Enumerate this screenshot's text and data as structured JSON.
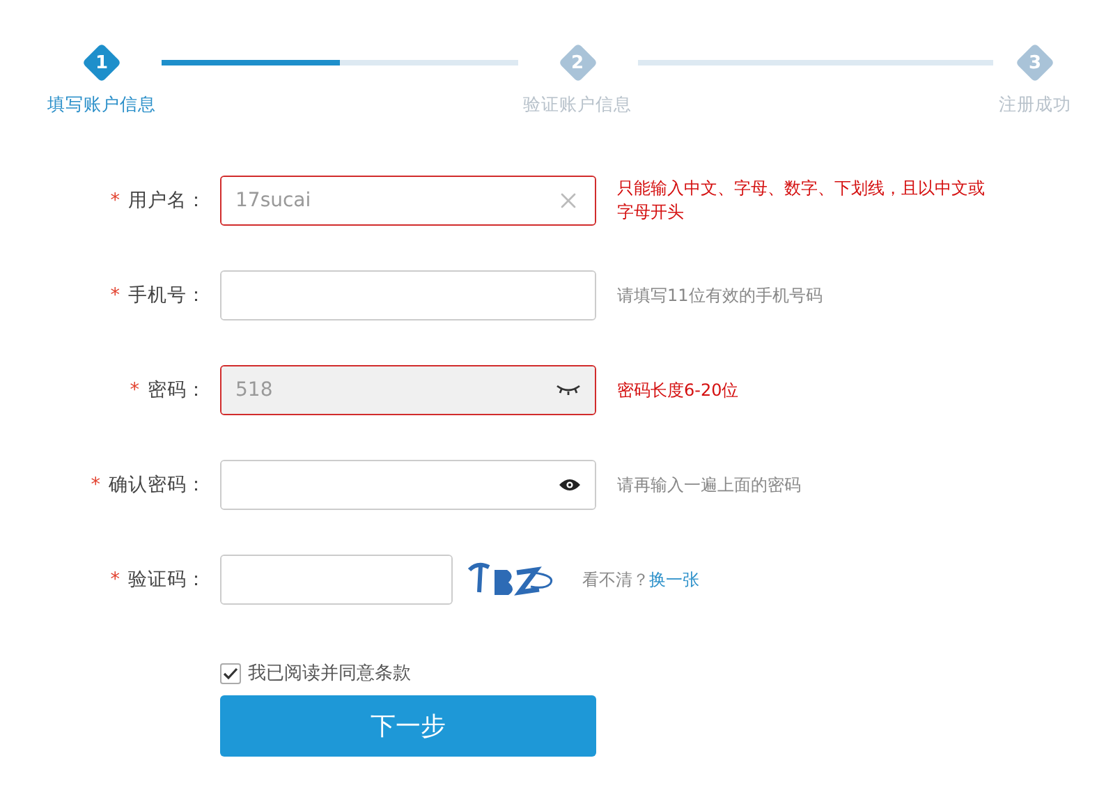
{
  "steps": [
    {
      "number": "1",
      "label": "填写账户信息",
      "active": true
    },
    {
      "number": "2",
      "label": "验证账户信息",
      "active": false
    },
    {
      "number": "3",
      "label": "注册成功",
      "active": false
    }
  ],
  "connectors": [
    {
      "level": 0.5
    }
  ],
  "fields": [
    {
      "kind": "clearable",
      "required": "*",
      "label": "用户名：",
      "value": "17sucai",
      "error": true,
      "filled": false,
      "hint": "只能输入中文、字母、数字、下划线，且以中文或字母开头"
    },
    {
      "kind": "plain",
      "required": "*",
      "label": "手机号：",
      "error": false,
      "filled": false,
      "hint": "请填写11位有效的手机号码"
    },
    {
      "kind": "password-hidden",
      "required": "*",
      "label": "密码：",
      "value": "518",
      "error": true,
      "filled": true,
      "hint": "密码长度6-20位"
    },
    {
      "kind": "password-shown",
      "required": "*",
      "label": "确认密码：",
      "error": false,
      "filled": false,
      "hint": "请再输入一遍上面的密码"
    },
    {
      "kind": "captcha",
      "required": "*",
      "label": "验证码：",
      "error": false,
      "filled": false,
      "hint": "看不清？",
      "link": "换一张"
    }
  ],
  "agree": {
    "label": "我已阅读并同意条款",
    "checked": true
  },
  "submit": "下一步"
}
